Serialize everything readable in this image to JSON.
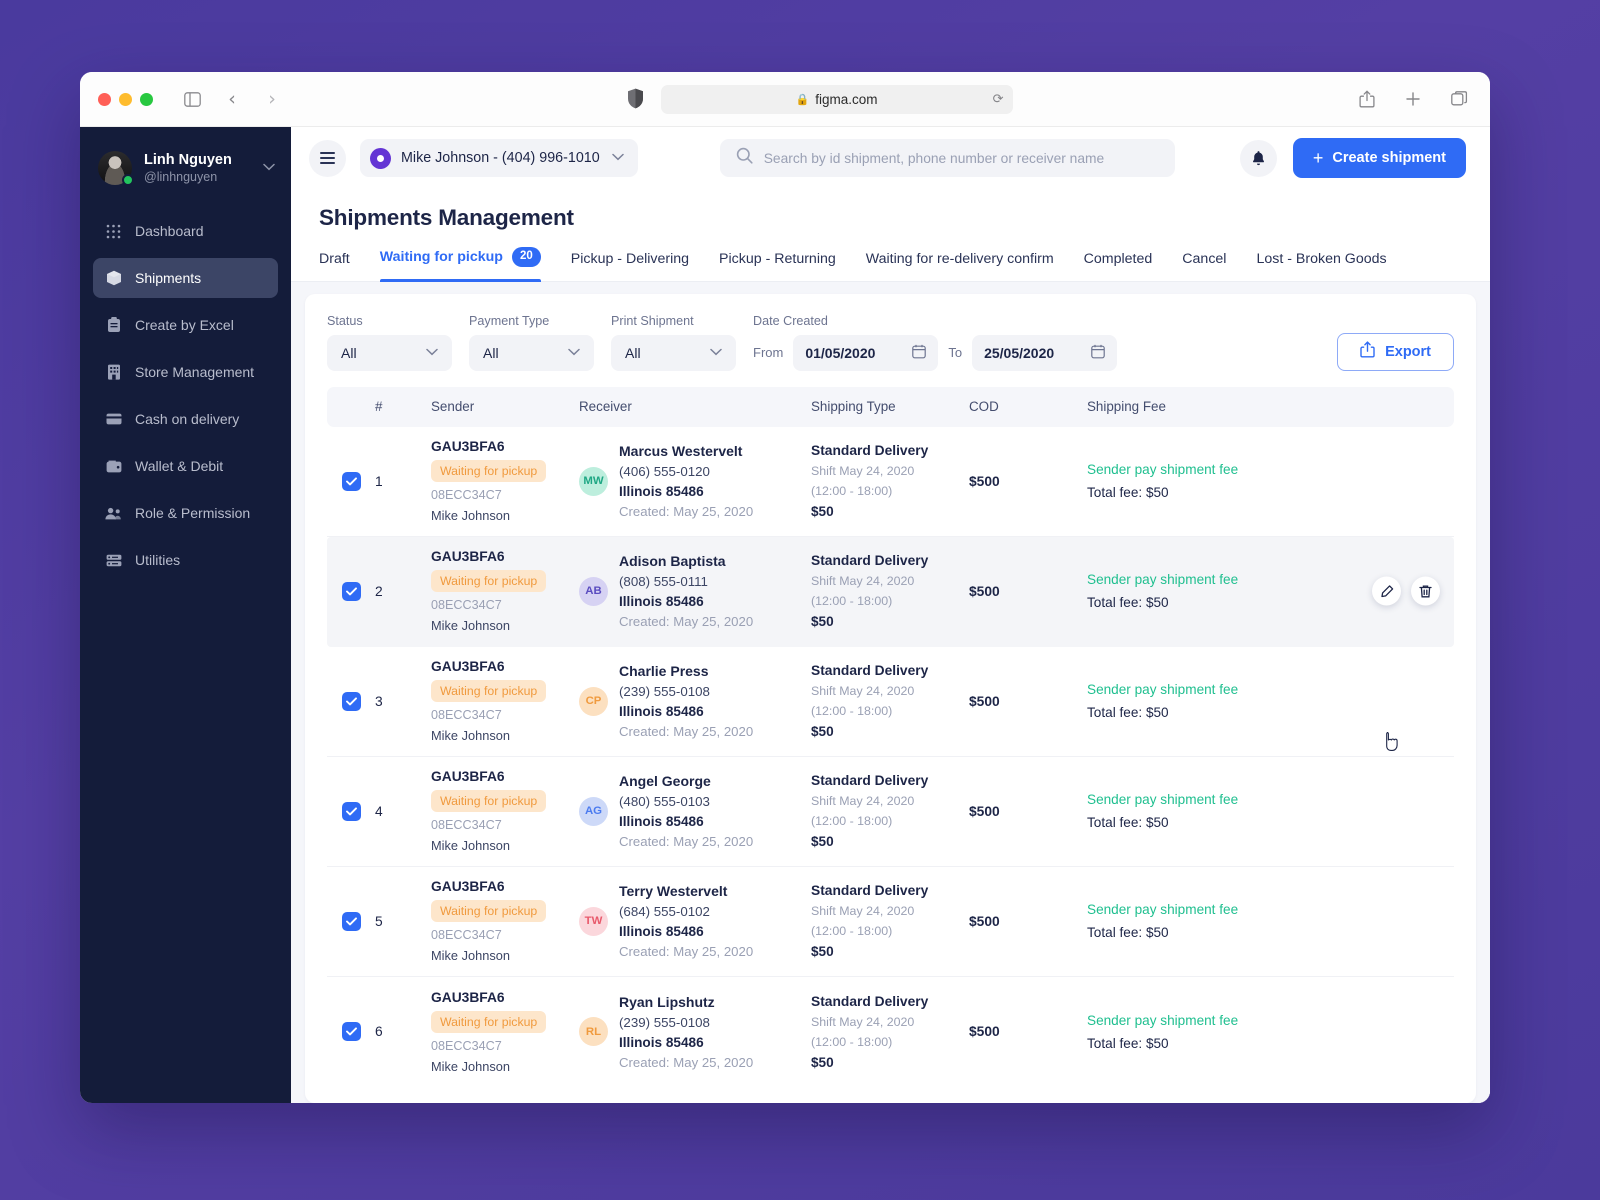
{
  "browser": {
    "url": "figma.com",
    "lock_icon": "lock-icon",
    "reload_icon": "reload-icon",
    "shield_icon": "shield-icon",
    "sidebar_toggle_icon": "sidebar-toggle-icon",
    "back_icon": "back-arrow-icon",
    "forward_icon": "forward-arrow-icon",
    "share_icon": "share-icon",
    "newtab_icon": "new-tab-icon",
    "tabs_icon": "tab-overview-icon"
  },
  "sidebar": {
    "profile": {
      "name": "Linh Nguyen",
      "handle": "@linhnguyen",
      "status": "online",
      "caret_icon": "chevron-down-icon"
    },
    "items": [
      {
        "label": "Dashboard",
        "icon": "grid-icon",
        "active": false
      },
      {
        "label": "Shipments",
        "icon": "box-icon",
        "active": true
      },
      {
        "label": "Create by Excel",
        "icon": "clipboard-icon",
        "active": false
      },
      {
        "label": "Store Management",
        "icon": "building-icon",
        "active": false
      },
      {
        "label": "Cash on delivery",
        "icon": "card-icon",
        "active": false
      },
      {
        "label": "Wallet & Debit",
        "icon": "wallet-icon",
        "active": false
      },
      {
        "label": "Role & Permission",
        "icon": "users-icon",
        "active": false
      },
      {
        "label": "Utilities",
        "icon": "server-icon",
        "active": false
      }
    ]
  },
  "topbar": {
    "menu_icon": "hamburger-icon",
    "location": {
      "text": "Mike Johnson - (404) 996-1010",
      "pin_icon": "location-pin-icon",
      "caret_icon": "chevron-down-icon"
    },
    "search": {
      "placeholder": "Search by id shipment, phone number or receiver name",
      "value": "",
      "icon": "search-icon"
    },
    "notification_icon": "bell-icon",
    "create_button": {
      "label": "Create shipment",
      "icon": "plus-icon"
    }
  },
  "page": {
    "title": "Shipments Management"
  },
  "tabs": [
    {
      "label": "Draft",
      "badge": null,
      "active": false
    },
    {
      "label": "Waiting for pickup",
      "badge": "20",
      "active": true
    },
    {
      "label": "Pickup - Delivering",
      "badge": null,
      "active": false
    },
    {
      "label": "Pickup - Returning",
      "badge": null,
      "active": false
    },
    {
      "label": "Waiting for re-delivery confirm",
      "badge": null,
      "active": false
    },
    {
      "label": "Completed",
      "badge": null,
      "active": false
    },
    {
      "label": "Cancel",
      "badge": null,
      "active": false
    },
    {
      "label": "Lost - Broken Goods",
      "badge": null,
      "active": false
    }
  ],
  "filters": {
    "status": {
      "label": "Status",
      "value": "All"
    },
    "payment_type": {
      "label": "Payment Type",
      "value": "All"
    },
    "print_shipment": {
      "label": "Print Shipment",
      "value": "All"
    },
    "date_created": {
      "label": "Date Created",
      "from_prefix": "From",
      "from_value": "01/05/2020",
      "to_prefix": "To",
      "to_value": "25/05/2020",
      "calendar_icon": "calendar-icon"
    },
    "export_button": {
      "label": "Export",
      "icon": "upload-icon"
    }
  },
  "table": {
    "columns": [
      "#",
      "Sender",
      "Receiver",
      "Shipping Type",
      "COD",
      "Shipping Fee"
    ],
    "rows": [
      {
        "num": "1",
        "checked": true,
        "ship_id": "GAU3BFA6",
        "status": "Waiting for pickup",
        "sender_code": "08ECC34C7",
        "sender_name": "Mike Johnson",
        "receiver_name": "Marcus Westervelt",
        "receiver_initials": "MW",
        "avatar_bg": "#bdeedd",
        "avatar_fg": "#1fa784",
        "phone": "(406) 555-0120",
        "address": "Illinois 85486",
        "created": "Created: May 25, 2020",
        "shipping_type": "Standard Delivery",
        "shift": "Shift May 24, 2020",
        "time_window": "(12:00 - 18:00)",
        "ship_price": "$50",
        "cod": "$500",
        "fee_who": "Sender pay shipment fee",
        "fee_total": "Total fee: $50",
        "hover": false
      },
      {
        "num": "2",
        "checked": true,
        "ship_id": "GAU3BFA6",
        "status": "Waiting for pickup",
        "sender_code": "08ECC34C7",
        "sender_name": "Mike Johnson",
        "receiver_name": "Adison Baptista",
        "receiver_initials": "AB",
        "avatar_bg": "#d6d2f3",
        "avatar_fg": "#5a4cc0",
        "phone": "(808) 555-0111",
        "address": "Illinois 85486",
        "created": "Created: May 25, 2020",
        "shipping_type": "Standard Delivery",
        "shift": "Shift May 24, 2020",
        "time_window": "(12:00 - 18:00)",
        "ship_price": "$50",
        "cod": "$500",
        "fee_who": "Sender pay shipment fee",
        "fee_total": "Total fee: $50",
        "hover": true,
        "actions": [
          {
            "name": "edit-row-button",
            "icon": "pencil-icon"
          },
          {
            "name": "delete-row-button",
            "icon": "trash-icon"
          }
        ]
      },
      {
        "num": "3",
        "checked": true,
        "ship_id": "GAU3BFA6",
        "status": "Waiting for pickup",
        "sender_code": "08ECC34C7",
        "sender_name": "Mike Johnson",
        "receiver_name": "Charlie Press",
        "receiver_initials": "CP",
        "avatar_bg": "#fce0c0",
        "avatar_fg": "#f09a3e",
        "phone": "(239) 555-0108",
        "address": "Illinois 85486",
        "created": "Created: May 25, 2020",
        "shipping_type": "Standard Delivery",
        "shift": "Shift May 24, 2020",
        "time_window": "(12:00 - 18:00)",
        "ship_price": "$50",
        "cod": "$500",
        "fee_who": "Sender pay shipment fee",
        "fee_total": "Total fee: $50",
        "hover": false
      },
      {
        "num": "4",
        "checked": true,
        "ship_id": "GAU3BFA6",
        "status": "Waiting for pickup",
        "sender_code": "08ECC34C7",
        "sender_name": "Mike Johnson",
        "receiver_name": "Angel George",
        "receiver_initials": "AG",
        "avatar_bg": "#cdd9f8",
        "avatar_fg": "#4b7bf0",
        "phone": "(480) 555-0103",
        "address": "Illinois 85486",
        "created": "Created: May 25, 2020",
        "shipping_type": "Standard Delivery",
        "shift": "Shift May 24, 2020",
        "time_window": "(12:00 - 18:00)",
        "ship_price": "$50",
        "cod": "$500",
        "fee_who": "Sender pay shipment fee",
        "fee_total": "Total fee: $50",
        "hover": false
      },
      {
        "num": "5",
        "checked": true,
        "ship_id": "GAU3BFA6",
        "status": "Waiting for pickup",
        "sender_code": "08ECC34C7",
        "sender_name": "Mike Johnson",
        "receiver_name": "Terry Westervelt",
        "receiver_initials": "TW",
        "avatar_bg": "#fbd7dc",
        "avatar_fg": "#e8596b",
        "phone": "(684) 555-0102",
        "address": "Illinois 85486",
        "created": "Created: May 25, 2020",
        "shipping_type": "Standard Delivery",
        "shift": "Shift May 24, 2020",
        "time_window": "(12:00 - 18:00)",
        "ship_price": "$50",
        "cod": "$500",
        "fee_who": "Sender pay shipment fee",
        "fee_total": "Total fee: $50",
        "hover": false
      },
      {
        "num": "6",
        "checked": true,
        "ship_id": "GAU3BFA6",
        "status": "Waiting for pickup",
        "sender_code": "08ECC34C7",
        "sender_name": "Mike Johnson",
        "receiver_name": "Ryan Lipshutz",
        "receiver_initials": "RL",
        "avatar_bg": "#fce0c0",
        "avatar_fg": "#f09a3e",
        "phone": "(239) 555-0108",
        "address": "Illinois 85486",
        "created": "Created: May 25, 2020",
        "shipping_type": "Standard Delivery",
        "shift": "Shift May 24, 2020",
        "time_window": "(12:00 - 18:00)",
        "ship_price": "$50",
        "cod": "$500",
        "fee_who": "Sender pay shipment fee",
        "fee_total": "Total fee: $50",
        "hover": false
      }
    ]
  },
  "colors": {
    "accent": "#2f6bf5",
    "sidebar_bg": "#141c3a",
    "status_pill_bg": "#fde6cb",
    "status_pill_fg": "#f09a3e",
    "fee_green": "#1fbf8f",
    "page_bg": "#4b3a9c"
  }
}
